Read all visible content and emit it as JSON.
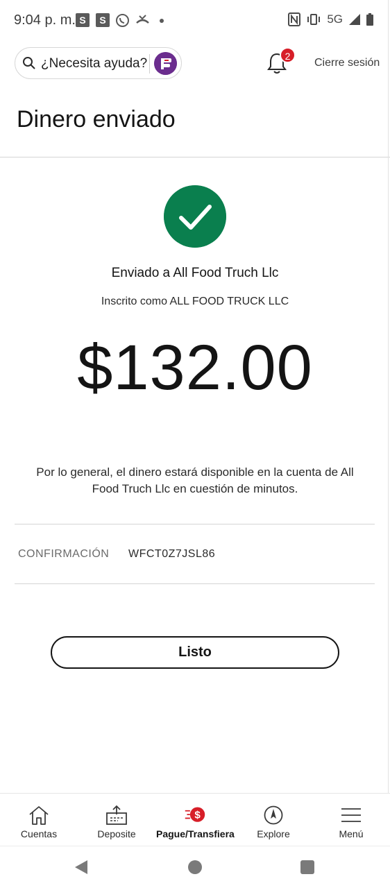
{
  "status_bar": {
    "time": "9:04 p. m.",
    "network": "5G"
  },
  "header": {
    "help_placeholder": "¿Necesita ayuda?",
    "notification_count": "2",
    "logout_label": "Cierre sesión"
  },
  "page": {
    "title": "Dinero enviado"
  },
  "confirmation": {
    "sent_to": "Enviado a All Food Truch Llc",
    "enrolled_as": "Inscrito como ALL FOOD TRUCK LLC",
    "amount": "$132.00",
    "notice": "Por lo general, el dinero estará disponible en la cuenta de All Food Truch Llc en cuestión de minutos.",
    "label": "CONFIRMACIÓN",
    "code": "WFCT0Z7JSL86",
    "done_label": "Listo"
  },
  "bottom_nav": {
    "items": [
      {
        "label": "Cuentas",
        "icon": "home-icon"
      },
      {
        "label": "Deposite",
        "icon": "deposit-icon"
      },
      {
        "label": "Pague/Transfiera",
        "icon": "pay-transfer-icon"
      },
      {
        "label": "Explore",
        "icon": "compass-icon"
      },
      {
        "label": "Menú",
        "icon": "menu-icon"
      }
    ]
  },
  "colors": {
    "success": "#0a7f4e",
    "brand_red": "#d71e28",
    "brand_purple": "#6b2d8e"
  }
}
